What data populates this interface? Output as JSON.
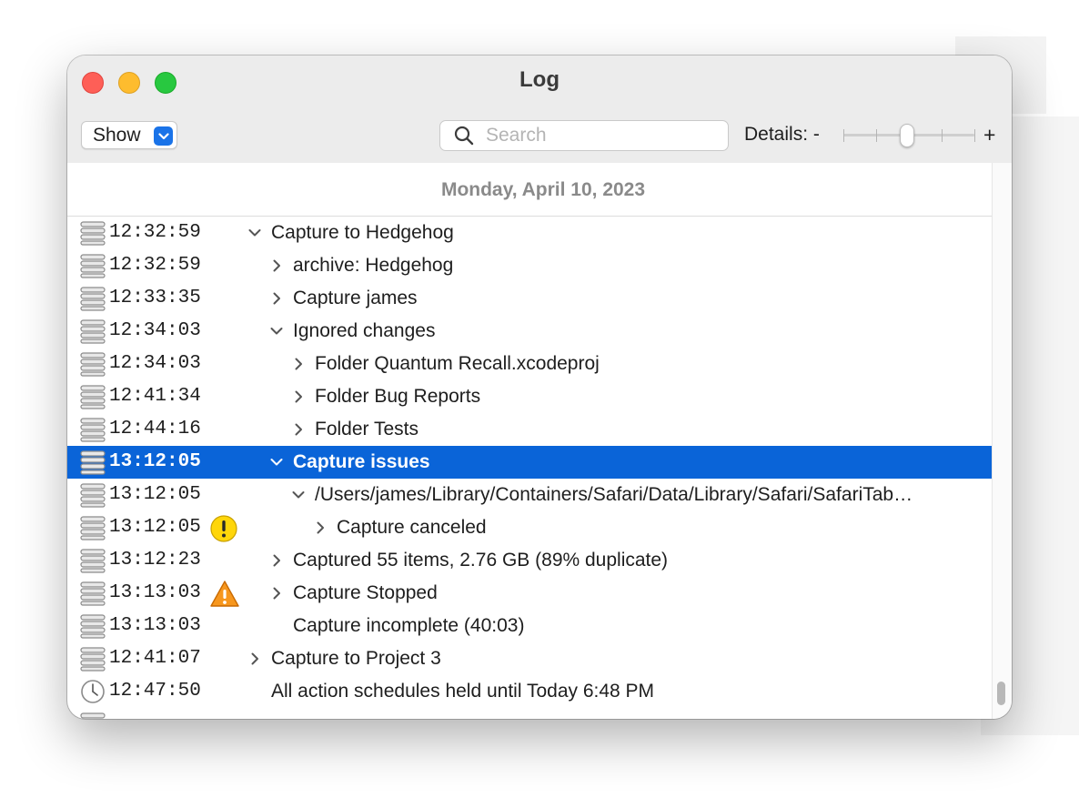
{
  "window": {
    "title": "Log"
  },
  "toolbar": {
    "show_label": "Show",
    "search_placeholder": "Search",
    "details_label": "Details: -",
    "details_plus": "+",
    "details_level": 0.5
  },
  "date_header": "Monday, April 10, 2023",
  "rows": [
    {
      "time": "12:32:59",
      "message": "Capture to Hedgehog",
      "expanded": "down",
      "icon": "log-stack"
    },
    {
      "time": "12:32:59",
      "message": "archive: Hedgehog",
      "expanded": "right",
      "icon": "log-stack"
    },
    {
      "time": "12:33:35",
      "message": "Capture james",
      "expanded": "right",
      "icon": "log-stack"
    },
    {
      "time": "12:34:03",
      "message": "Ignored changes",
      "expanded": "down",
      "icon": "log-stack"
    },
    {
      "time": "12:34:03",
      "message": "Folder Quantum Recall.xcodeproj",
      "expanded": "right",
      "icon": "log-stack"
    },
    {
      "time": "12:41:34",
      "message": "Folder Bug Reports",
      "expanded": "right",
      "icon": "log-stack"
    },
    {
      "time": "12:44:16",
      "message": "Folder Tests",
      "expanded": "right",
      "icon": "log-stack"
    },
    {
      "time": "13:12:05",
      "message": "Capture issues",
      "expanded": "down",
      "icon": "log-stack",
      "selected": true
    },
    {
      "time": "13:12:05",
      "message": "/Users/james/Library/Containers/Safari/Data/Library/Safari/SafariTab…",
      "expanded": "down",
      "icon": "log-stack"
    },
    {
      "time": "13:12:05",
      "message": "Capture canceled",
      "expanded": "right",
      "icon": "log-stack",
      "status": "caution-icon"
    },
    {
      "time": "13:12:23",
      "message": "Captured 55 items, 2.76 GB (89% duplicate)",
      "expanded": "right",
      "icon": "log-stack"
    },
    {
      "time": "13:13:03",
      "message": "Capture Stopped",
      "expanded": "right",
      "icon": "log-stack",
      "status": "warning-icon"
    },
    {
      "time": "13:13:03",
      "message": "Capture incomplete (40:03)",
      "icon": "log-stack"
    },
    {
      "time": "12:41:07",
      "message": "Capture to Project 3",
      "expanded": "right",
      "icon": "log-stack"
    },
    {
      "time": "12:47:50",
      "message": "All action schedules held until Today 6:48 PM",
      "icon": "clock"
    }
  ],
  "colors": {
    "selection": "#0a64d8",
    "close": "#fe5f57",
    "minimize": "#febc2e",
    "maximize": "#28c840"
  }
}
